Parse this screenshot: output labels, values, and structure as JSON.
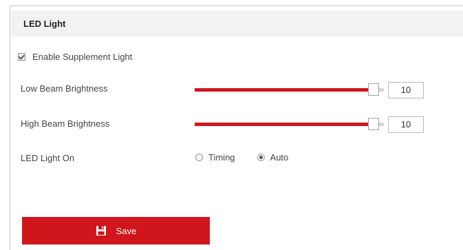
{
  "section": {
    "title": "LED Light"
  },
  "supplement_light": {
    "label": "Enable Supplement Light",
    "checked": true
  },
  "low_beam": {
    "label": "Low Beam Brightness",
    "value": "10",
    "level_fraction": 1.0
  },
  "high_beam": {
    "label": "High Beam Brightness",
    "value": "10",
    "level_fraction": 1.0
  },
  "led_light_on": {
    "label": "LED Light On",
    "options": [
      {
        "label": "Timing",
        "selected": false
      },
      {
        "label": "Auto",
        "selected": true
      }
    ]
  },
  "save_button": {
    "label": "Save",
    "icon": "save-icon"
  },
  "colors": {
    "accent": "#d0161c",
    "header_bg": "#f2f2f2"
  }
}
